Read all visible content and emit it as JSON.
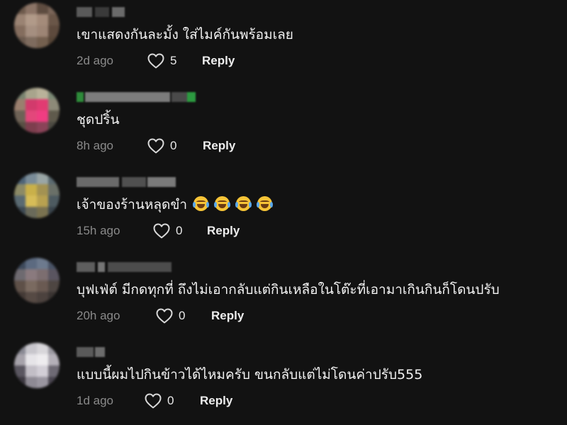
{
  "comments": [
    {
      "text": "เขาแสดงกันละมั้ง ใส่ไมค์กันพร้อมเลย",
      "time": "2d ago",
      "likes": "5",
      "reply_label": "Reply",
      "emoji_count": 0,
      "avatar_colors": [
        "#6e5a4c",
        "#8b7466",
        "#5e4c40",
        "#7a6558",
        "#9a8373",
        "#b19a89",
        "#a48b7a",
        "#6a5648",
        "#846d5e",
        "#a58f80",
        "#9d8575",
        "#5d4a3d",
        "#6b5a4e",
        "#7e6b5e",
        "#74604f",
        "#564537"
      ],
      "username_colors": [
        "#5a5a5a",
        "#3a3a3a",
        "#6a6a6a"
      ]
    },
    {
      "text": "ชุดปริ้น",
      "time": "8h ago",
      "likes": "0",
      "reply_label": "Reply",
      "emoji_count": 0,
      "avatar_colors": [
        "#7a8470",
        "#a8a48c",
        "#b9b29a",
        "#7c8a76",
        "#9a7f6e",
        "#d23a6c",
        "#e13b72",
        "#8d8a78",
        "#6e6256",
        "#e3477b",
        "#f03d82",
        "#5f5a4c",
        "#585044",
        "#7d3e4e",
        "#8a4358",
        "#4c4a42"
      ],
      "username_colors": [
        "#2e8b3a",
        "#7c7c7c",
        "#4a4a4a",
        "#2c9a40"
      ]
    },
    {
      "text": "เจ้าของร้านหลุดขำ",
      "time": "15h ago",
      "likes": "0",
      "reply_label": "Reply",
      "emoji_count": 4,
      "avatar_colors": [
        "#4e6478",
        "#7a8c98",
        "#9aa6a6",
        "#5b6a70",
        "#8c8a66",
        "#c9b04a",
        "#a39252",
        "#6a7068",
        "#5a6a72",
        "#d6bc58",
        "#b8a150",
        "#4d5a60",
        "#3e4a54",
        "#6a6a5a",
        "#7a7250",
        "#3a444c"
      ],
      "username_colors": [
        "#6a6a6a",
        "#505050",
        "#7a7a7a"
      ]
    },
    {
      "text": "บุฟเฟ่ต์ มีกดทุกที่ ถึงไม่เอากลับแต่กินเหลือในโต๊ะที่เอามาเกินกินก็โดนปรับ",
      "time": "20h ago",
      "likes": "0",
      "reply_label": "Reply",
      "emoji_count": 0,
      "avatar_colors": [
        "#3e4a5c",
        "#5c6a80",
        "#6d7a8e",
        "#4a5466",
        "#6e6a70",
        "#8a7a7e",
        "#7c6e70",
        "#5a5560",
        "#5e5048",
        "#7a6a60",
        "#6a5a52",
        "#4e4642",
        "#443a36",
        "#564a44",
        "#4c423e",
        "#3a3432"
      ],
      "username_colors": [
        "#5e5e5e",
        "#757575",
        "#4c4c4c"
      ]
    },
    {
      "text": "แบบนี้ผมไปกินข้าวได้ไหมครับ ขนกลับแต่ไม่โดนค่าปรับ555",
      "time": "1d ago",
      "likes": "0",
      "reply_label": "Reply",
      "emoji_count": 0,
      "avatar_colors": [
        "#8a8a94",
        "#c8c6cc",
        "#d8d6da",
        "#9c9aa2",
        "#a6a2aa",
        "#e6e4e8",
        "#eeecef",
        "#b4b0b8",
        "#5a5660",
        "#c2bec6",
        "#d2ced6",
        "#6e6a74",
        "#3e3a42",
        "#8e8a94",
        "#9a96a0",
        "#4a4650"
      ],
      "username_colors": [
        "#5a5a5a",
        "#6c6c6c"
      ]
    }
  ],
  "icons": {
    "heart": "heart-outline-icon"
  }
}
